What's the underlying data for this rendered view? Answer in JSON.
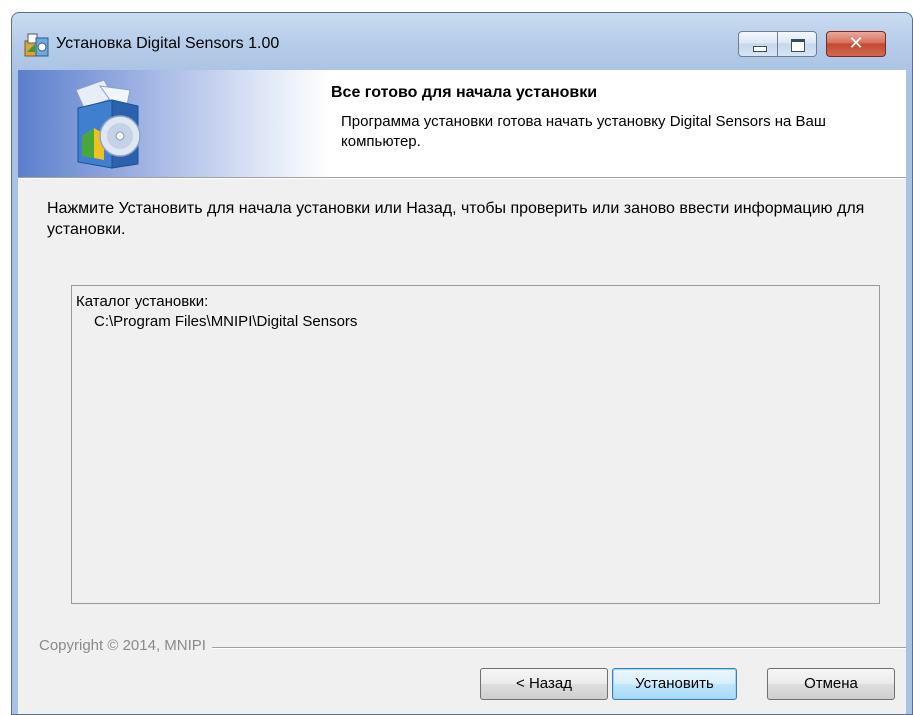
{
  "window": {
    "title": "Установка Digital Sensors 1.00",
    "controls": {
      "minimize": "minimize-icon",
      "maximize": "maximize-icon",
      "close": "✕"
    }
  },
  "header": {
    "title": "Все готово для начала установки",
    "subtitle": "Программа установки готова начать установку Digital Sensors на Ваш компьютер.",
    "icon": "software-box-disc-icon"
  },
  "body": {
    "instructions": "Нажмите Установить для начала установки или Назад, чтобы проверить или заново ввести информацию для установки.",
    "info": {
      "label": "Каталог установки:",
      "value": "C:\\Program Files\\MNIPI\\Digital Sensors"
    }
  },
  "footer": {
    "copyright": "Copyright © 2014, MNIPI",
    "buttons": {
      "back": "< Назад",
      "install": "Установить",
      "cancel": "Отмена"
    }
  },
  "colors": {
    "title_bar": "#b6cde9",
    "header_gradient_start": "#5c7fcc",
    "client_background": "#f0f0f0",
    "close_button": "#c24a32",
    "default_button_border": "#3c7fb1"
  }
}
